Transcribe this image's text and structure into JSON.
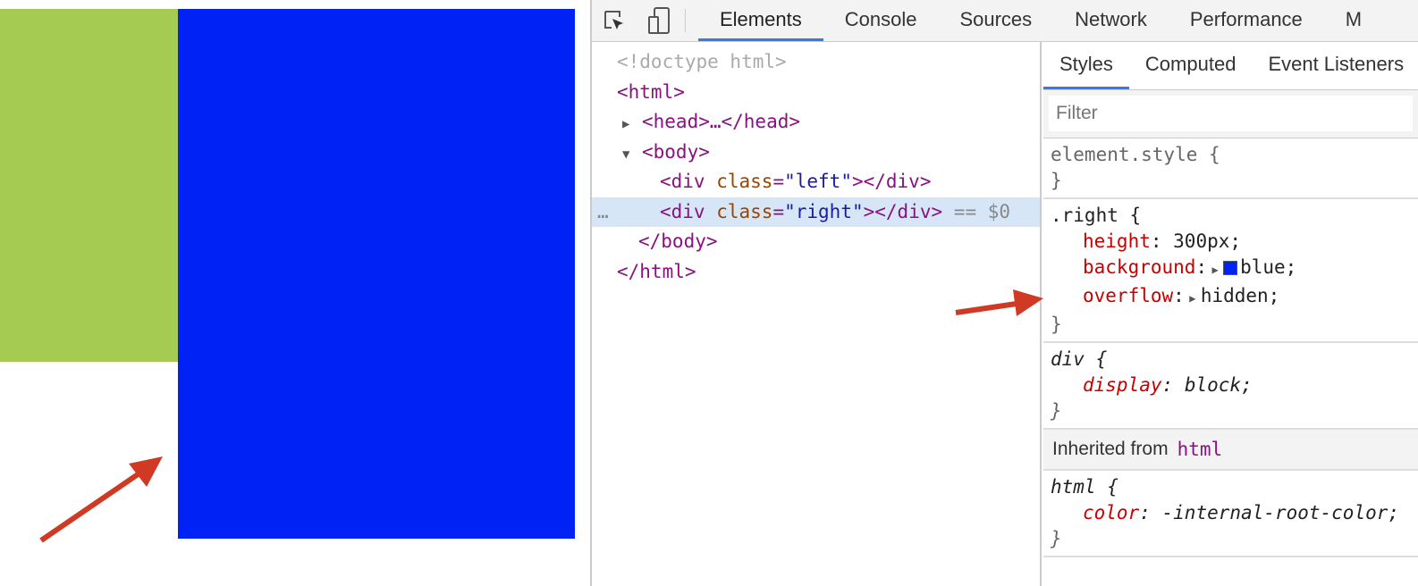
{
  "page": {
    "left_color": "#a6cb52",
    "right_color": "#0022f5",
    "arrow_color": "#d03a24"
  },
  "devtools": {
    "tools": [
      {
        "icon": "inspect-element-icon"
      },
      {
        "icon": "device-toolbar-icon"
      }
    ],
    "tabs": [
      "Elements",
      "Console",
      "Sources",
      "Network",
      "Performance",
      "M"
    ],
    "active_tab": "Elements",
    "dom": {
      "doctype": "<!doctype html>",
      "html_open": "<html>",
      "head": "<head>…</head>",
      "body_open": "<body>",
      "div_open": "<div",
      "class_attr": "class",
      "left_val": "\"left\"",
      "right_val": "\"right\"",
      "div_close": "></div>",
      "selected_marker": "== $0",
      "ellipsis": "…",
      "body_close": "</body>",
      "html_close": "</html>"
    },
    "styles": {
      "tabs": [
        "Styles",
        "Computed",
        "Event Listeners"
      ],
      "filter_placeholder": "Filter",
      "element_style": "element.style {",
      "close_brace": "}",
      "right_selector": ".right {",
      "right_props": [
        {
          "name": "height",
          "value": "300px;"
        },
        {
          "name": "background",
          "value": "blue;"
        },
        {
          "name": "overflow",
          "value": "hidden;"
        }
      ],
      "div_selector": "div {",
      "div_prop": {
        "name": "display",
        "value": "block;"
      },
      "inherited_label": "Inherited from",
      "inherited_tag": "html",
      "html_selector": "html {",
      "html_prop": {
        "name": "color",
        "value": "-internal-root-color;"
      }
    }
  }
}
